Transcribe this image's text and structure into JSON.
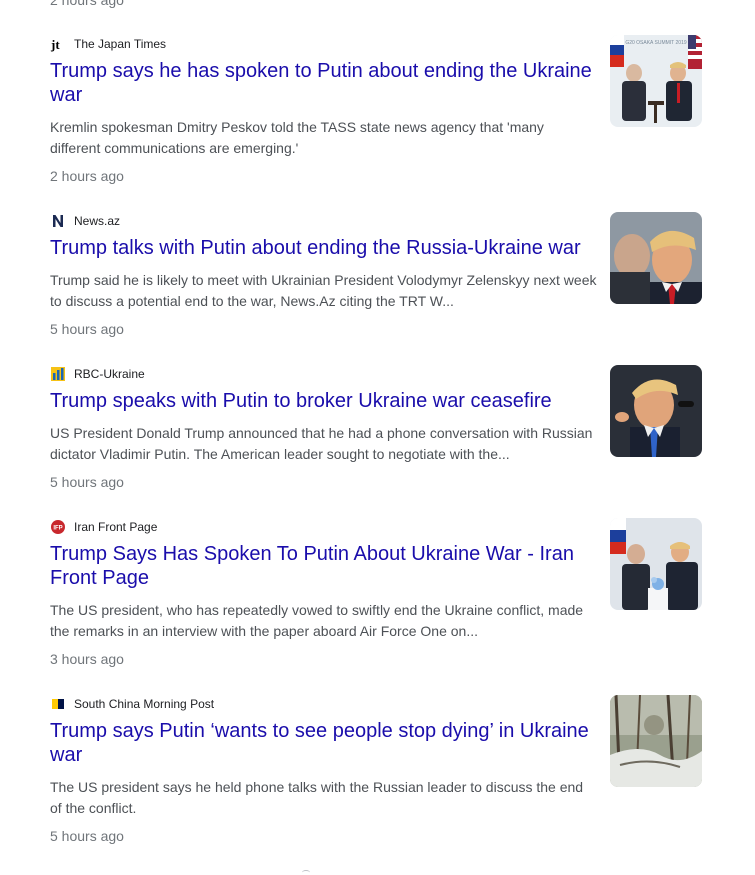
{
  "top_time": "2 hours ago",
  "articles": [
    {
      "source": "The Japan Times",
      "logo": "jt-logo-icon",
      "headline": "Trump says he has spoken to Putin about ending the Ukraine war",
      "snippet": "Kremlin spokesman Dmitry Peskov told the TASS state news agency that 'many different communications are emerging.'",
      "time": "2 hours ago",
      "thumb": "putin-trump-summit-thumbnail",
      "thumb_caption": "G20 OSAKA SUMMIT 2019"
    },
    {
      "source": "News.az",
      "logo": "newsaz-logo-icon",
      "headline": "Trump talks with Putin about ending the Russia-Ukraine war",
      "snippet": "Trump said he is likely to meet with Ukrainian President Volodymyr Zelenskyy next week to discuss a potential end to the war, News.Az citing the TRT W...",
      "time": "5 hours ago",
      "thumb": "putin-trump-closeup-thumbnail"
    },
    {
      "source": "RBC-Ukraine",
      "logo": "rbc-ukraine-logo-icon",
      "headline": "Trump speaks with Putin to broker Ukraine war ceasefire",
      "snippet": "US President Donald Trump announced that he had a phone conversation with Russian dictator Vladimir Putin. The American leader sought to negotiate with the...",
      "time": "5 hours ago",
      "thumb": "trump-speaking-thumbnail"
    },
    {
      "source": "Iran Front Page",
      "logo": "ifp-logo-icon",
      "headline": "Trump Says Has Spoken To Putin About Ukraine War - Iran Front Page",
      "snippet": "The US president, who has repeatedly vowed to swiftly end the Ukraine conflict, made the remarks in an interview with the paper aboard Air Force One on...",
      "time": "3 hours ago",
      "thumb": "putin-trump-meeting-thumbnail"
    },
    {
      "source": "South China Morning Post",
      "logo": "scmp-logo-icon",
      "headline": "Trump says Putin ‘wants to see people stop dying’ in Ukraine war",
      "snippet": "The US president says he held phone talks with the Russian leader to discuss the end of the conflict.",
      "time": "5 hours ago",
      "thumb": "snowy-forest-thumbnail"
    }
  ],
  "colors": {
    "headline": "#1a0dab",
    "snippet": "#4d5156",
    "time": "#70757a",
    "source": "#202124"
  }
}
